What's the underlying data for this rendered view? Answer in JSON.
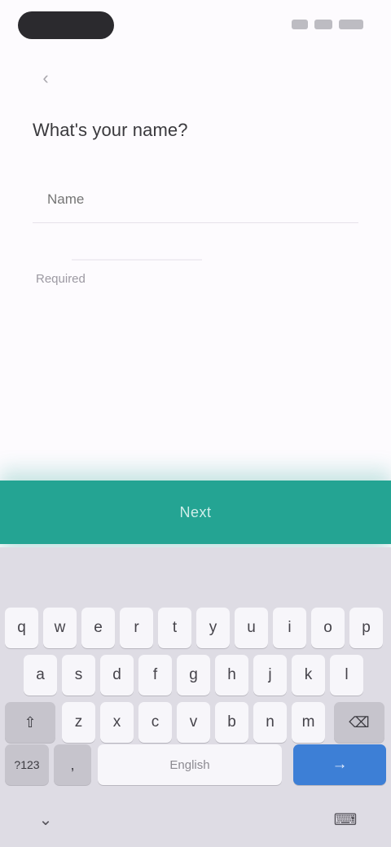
{
  "status_bar": {
    "icons": [
      "signal-icon",
      "wifi-icon",
      "battery-icon"
    ]
  },
  "screen": {
    "back_icon": "‹",
    "heading": "What's your name?",
    "name_input": {
      "value": "",
      "placeholder": "Name"
    },
    "helper": "Required"
  },
  "action": {
    "label": "Next",
    "color": "#24a493"
  },
  "keyboard": {
    "suggestions": [
      "",
      "",
      ""
    ],
    "row1": [
      "q",
      "w",
      "e",
      "r",
      "t",
      "y",
      "u",
      "i",
      "o",
      "p"
    ],
    "row2": [
      "a",
      "s",
      "d",
      "f",
      "g",
      "h",
      "j",
      "k",
      "l"
    ],
    "row3": [
      "z",
      "x",
      "c",
      "v",
      "b",
      "n",
      "m"
    ],
    "shift_icon": "⇧",
    "backspace_icon": "⌫",
    "symbols_label": "?123",
    "comma_label": ",",
    "space_label": "English",
    "period_label": ".",
    "enter_icon": "→",
    "nav_down_icon": "⌄",
    "nav_keyboard_icon": "⌨",
    "enter_color": "#3d7fd6"
  }
}
